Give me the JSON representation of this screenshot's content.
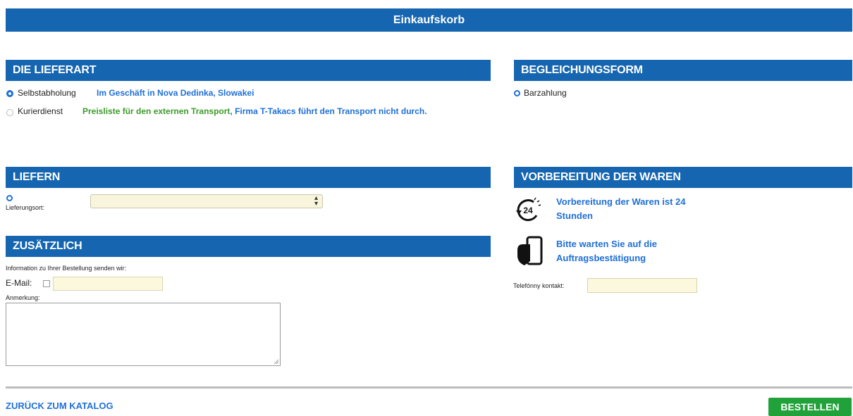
{
  "page": {
    "title": "Einkaufskorb"
  },
  "delivery_type": {
    "header": "DIE LIEFERART",
    "options": [
      {
        "label": "Selbstabholung",
        "note": "Im Geschäft in Nova Dedinka, Slowakei",
        "selected": true
      },
      {
        "label": "Kurierdienst",
        "note_part1": "Preisliste für den externen Transport",
        "note_part2": ", Firma T-Takacs führt den Transport nicht durch.",
        "selected": false
      }
    ]
  },
  "payment": {
    "header": "BEGLEICHUNGSFORM",
    "options": [
      {
        "label": "Barzahlung",
        "selected": true
      }
    ]
  },
  "deliver": {
    "header": "LIEFERN",
    "location_label": "Lieferungsort:",
    "location_value": ""
  },
  "preparation": {
    "header": "VORBEREITUNG DER WAREN",
    "line1": "Vorbereitung der Waren ist 24",
    "line1b": "Stunden",
    "clock_text": "24",
    "line2": "Bitte warten Sie auf die",
    "line2b": "Auftragsbestätigung",
    "phone_label": "Telefónny kontakt:",
    "phone_value": ""
  },
  "additional": {
    "header": "ZUSÄTZLICH",
    "info_text": "Information zu Ihrer Bestellung senden wir:",
    "email_label": "E-Mail:",
    "email_value": "",
    "note_label": "Anmerkung:",
    "note_value": ""
  },
  "footer": {
    "back_label": "ZURÜCK ZUM KATALOG",
    "order_label": "BESTELLEN"
  },
  "colors": {
    "bar_blue": "#1565b0",
    "link_blue": "#1f6fd6",
    "note_green": "#3c9a2a",
    "order_green": "#21a13a"
  }
}
